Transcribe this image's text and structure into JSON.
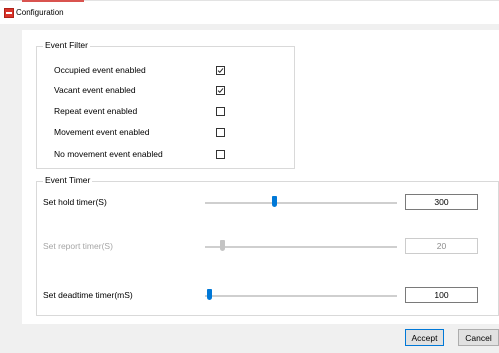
{
  "window": {
    "title": "Configuration",
    "icon": "app-icon",
    "accent_color": "#d9342b"
  },
  "event_filter": {
    "title": "Event Filter",
    "items": [
      {
        "label": "Occupied event enabled",
        "checked": true
      },
      {
        "label": "Vacant event enabled",
        "checked": true
      },
      {
        "label": "Repeat event enabled",
        "checked": false
      },
      {
        "label": "Movement event enabled",
        "checked": false
      },
      {
        "label": "No movement event enabled",
        "checked": false
      }
    ]
  },
  "event_timer": {
    "title": "Event Timer",
    "timers": [
      {
        "label": "Set hold timer(S)",
        "value": "300",
        "slider_fraction": 0.36,
        "enabled": true
      },
      {
        "label": "Set report timer(S)",
        "value": "20",
        "slider_fraction": 0.09,
        "enabled": false
      },
      {
        "label": "Set deadtime timer(mS)",
        "value": "100",
        "slider_fraction": 0.02,
        "enabled": true
      }
    ]
  },
  "buttons": {
    "accept": "Accept",
    "cancel": "Cancel"
  },
  "colors": {
    "slider_active": "#0078d7",
    "slider_disabled": "#c4c4c4",
    "primary_border": "#0078d7"
  }
}
